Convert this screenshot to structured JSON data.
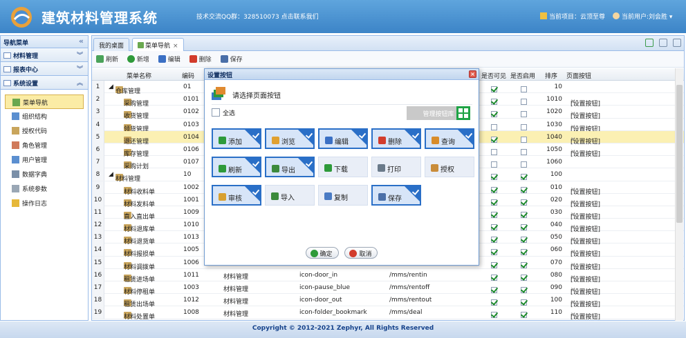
{
  "header": {
    "app_title": "建筑材料管理系统",
    "qq_text": "技术交流QQ群：328510073 点击联系我们",
    "project_text": "当前项目：云顶至尊",
    "user_text": "当前用户:刘会胜"
  },
  "sidebar": {
    "title": "导航菜单",
    "groups": [
      {
        "label": "材料管理"
      },
      {
        "label": "报表中心"
      },
      {
        "label": "系统设置"
      }
    ],
    "items": [
      {
        "label": "菜单导航"
      },
      {
        "label": "组织结构"
      },
      {
        "label": "授权代码"
      },
      {
        "label": "角色管理"
      },
      {
        "label": "用户管理"
      },
      {
        "label": "数据字典"
      },
      {
        "label": "系统参数"
      },
      {
        "label": "操作日志"
      }
    ]
  },
  "tabs": [
    {
      "label": "我的桌面"
    },
    {
      "label": "菜单导航"
    }
  ],
  "toolbar": {
    "refresh": "刷新",
    "add": "新增",
    "edit": "编辑",
    "delete": "删除",
    "save": "保存"
  },
  "grid": {
    "columns": {
      "name": "菜单名称",
      "code": "编码",
      "visible": "是否可见",
      "enabled": "是否启用",
      "sort": "排序",
      "page_button": "页面按钮"
    },
    "rows": [
      {
        "n": "1",
        "name": "仓库管理",
        "code": "01",
        "parent": "",
        "icon": "",
        "url": "",
        "vis": true,
        "en": false,
        "sort": "10",
        "btn": ""
      },
      {
        "n": "2",
        "name": "采购管理",
        "code": "0101",
        "parent": "",
        "icon": "",
        "url": "",
        "vis": true,
        "en": false,
        "sort": "1010",
        "btn": "[设置按钮]"
      },
      {
        "n": "3",
        "name": "收货管理",
        "code": "0102",
        "parent": "",
        "icon": "",
        "url": "",
        "vis": true,
        "en": false,
        "sort": "1020",
        "btn": "[设置按钮]"
      },
      {
        "n": "4",
        "name": "领货管理",
        "code": "0103",
        "parent": "",
        "icon": "",
        "url": "",
        "vis": false,
        "en": false,
        "sort": "1030",
        "btn": "[设置按钮]"
      },
      {
        "n": "5",
        "name": "退还管理",
        "code": "0104",
        "parent": "",
        "icon": "",
        "url": "",
        "vis": true,
        "en": false,
        "sort": "1040",
        "btn": "[设置按钮]"
      },
      {
        "n": "6",
        "name": "库存管理",
        "code": "0106",
        "parent": "",
        "icon": "",
        "url": "",
        "vis": false,
        "en": false,
        "sort": "1050",
        "btn": "[设置按钮]"
      },
      {
        "n": "7",
        "name": "采购计划",
        "code": "0107",
        "parent": "",
        "icon": "",
        "url": "",
        "vis": false,
        "en": false,
        "sort": "1060",
        "btn": ""
      },
      {
        "n": "8",
        "name": "材料管理",
        "code": "10",
        "parent": "",
        "icon": "",
        "url": "",
        "vis": true,
        "en": true,
        "sort": "100",
        "btn": ""
      },
      {
        "n": "9",
        "name": "材料收料单",
        "code": "1002",
        "parent": "",
        "icon": "",
        "url": "",
        "vis": true,
        "en": true,
        "sort": "010",
        "btn": "[设置按钮]"
      },
      {
        "n": "10",
        "name": "材料发料单",
        "code": "1001",
        "parent": "",
        "icon": "",
        "url": "",
        "vis": true,
        "en": true,
        "sort": "020",
        "btn": "[设置按钮]"
      },
      {
        "n": "11",
        "name": "直入直出单",
        "code": "1009",
        "parent": "",
        "icon": "",
        "url": "",
        "vis": true,
        "en": true,
        "sort": "030",
        "btn": "[设置按钮]"
      },
      {
        "n": "12",
        "name": "材料退库单",
        "code": "1010",
        "parent": "",
        "icon": "",
        "url": "",
        "vis": true,
        "en": true,
        "sort": "040",
        "btn": "[设置按钮]"
      },
      {
        "n": "13",
        "name": "材料退货单",
        "code": "1013",
        "parent": "",
        "icon": "",
        "url": "",
        "vis": true,
        "en": true,
        "sort": "050",
        "btn": "[设置按钮]"
      },
      {
        "n": "14",
        "name": "材料报损单",
        "code": "1005",
        "parent": "",
        "icon": "",
        "url": "",
        "vis": true,
        "en": true,
        "sort": "060",
        "btn": "[设置按钮]"
      },
      {
        "n": "15",
        "name": "材料调拨单",
        "code": "1006",
        "parent": "",
        "icon": "",
        "url": "",
        "vis": true,
        "en": true,
        "sort": "070",
        "btn": "[设置按钮]"
      },
      {
        "n": "16",
        "name": "租赁进场单",
        "code": "1011",
        "parent": "材料管理",
        "icon": "icon-door_in",
        "url": "/mms/rentin",
        "vis": true,
        "en": true,
        "sort": "080",
        "btn": "[设置按钮]"
      },
      {
        "n": "17",
        "name": "材料停租单",
        "code": "1003",
        "parent": "材料管理",
        "icon": "icon-pause_blue",
        "url": "/mms/rentoff",
        "vis": true,
        "en": true,
        "sort": "090",
        "btn": "[设置按钮]"
      },
      {
        "n": "18",
        "name": "租赁出场单",
        "code": "1012",
        "parent": "材料管理",
        "icon": "icon-door_out",
        "url": "/mms/rentout",
        "vis": true,
        "en": true,
        "sort": "100",
        "btn": "[设置按钮]"
      },
      {
        "n": "19",
        "name": "材料处置单",
        "code": "1008",
        "parent": "材料管理",
        "icon": "icon-folder_bookmark",
        "url": "/mms/deal",
        "vis": true,
        "en": true,
        "sort": "110",
        "btn": "[设置按钮]"
      }
    ]
  },
  "dialog": {
    "title": "设置按钮",
    "subtitle": "请选择页面按钮",
    "select_all": "全选",
    "manage_lib": "管理按钮库",
    "buttons": [
      {
        "label": "添加",
        "on": true,
        "color": "#2e9a3a"
      },
      {
        "label": "浏览",
        "on": true,
        "color": "#e0a030"
      },
      {
        "label": "编辑",
        "on": true,
        "color": "#3b70c4"
      },
      {
        "label": "删除",
        "on": true,
        "color": "#d23c2c"
      },
      {
        "label": "查询",
        "on": true,
        "color": "#d88c2a"
      },
      {
        "label": "刷新",
        "on": true,
        "color": "#2e9a3a"
      },
      {
        "label": "导出",
        "on": true,
        "color": "#3c8a3c"
      },
      {
        "label": "下载",
        "on": false,
        "color": "#2e9a3a"
      },
      {
        "label": "打印",
        "on": false,
        "color": "#6a7a8a"
      },
      {
        "label": "授权",
        "on": false,
        "color": "#c98c3a"
      },
      {
        "label": "审核",
        "on": true,
        "color": "#d8a030"
      },
      {
        "label": "导入",
        "on": false,
        "color": "#3c8a3c"
      },
      {
        "label": "复制",
        "on": false,
        "color": "#4a7bc4"
      },
      {
        "label": "保存",
        "on": true,
        "color": "#4a6fa8"
      }
    ],
    "ok": "确定",
    "cancel": "取消"
  },
  "footer": "Copyright © 2012-2021 Zephyr, All Rights Reserved"
}
